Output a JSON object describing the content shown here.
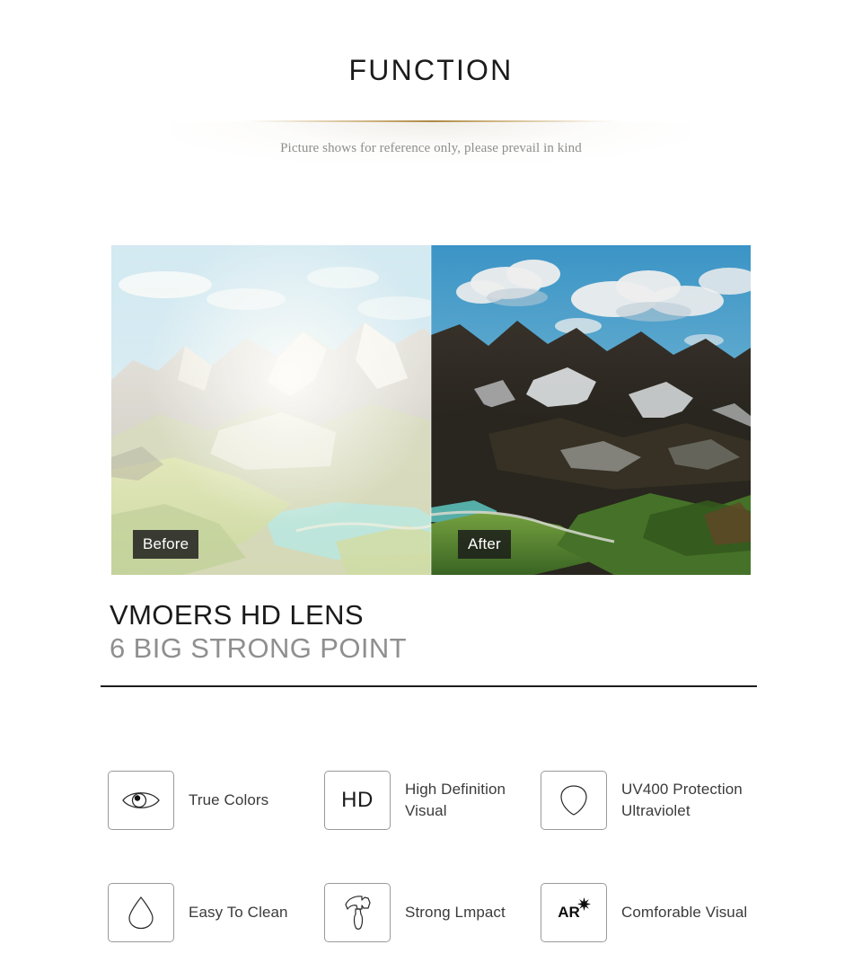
{
  "header": {
    "title": "FUNCTION",
    "subtitle": "Picture shows for reference only, please prevail in kind",
    "divider_color": "#a8823c"
  },
  "comparison": {
    "before_label": "Before",
    "after_label": "After",
    "scene": "alpine mountain lake landscape",
    "badge_bg": "#1a1a1a",
    "badge_text_color": "#ffffff"
  },
  "headings": {
    "primary": "VMOERS HD LENS",
    "secondary": "6 BIG STRONG POINT",
    "primary_color": "#1a1a1a",
    "secondary_color": "#8f8f8f"
  },
  "features": [
    [
      {
        "icon": "eye-icon",
        "icon_text": "",
        "label": "True Colors"
      },
      {
        "icon": "hd-text-icon",
        "icon_text": "HD",
        "label": "High Definition\nVisual"
      },
      {
        "icon": "shield-icon",
        "icon_text": "",
        "label": "UV400 Protection\nUltraviolet"
      }
    ],
    [
      {
        "icon": "water-drop-icon",
        "icon_text": "",
        "label": "Easy To Clean"
      },
      {
        "icon": "hammer-icon",
        "icon_text": "",
        "label": "Strong Lmpact"
      },
      {
        "icon": "ar-star-icon",
        "icon_text": "AR",
        "label": "Comforable Visual"
      }
    ]
  ]
}
